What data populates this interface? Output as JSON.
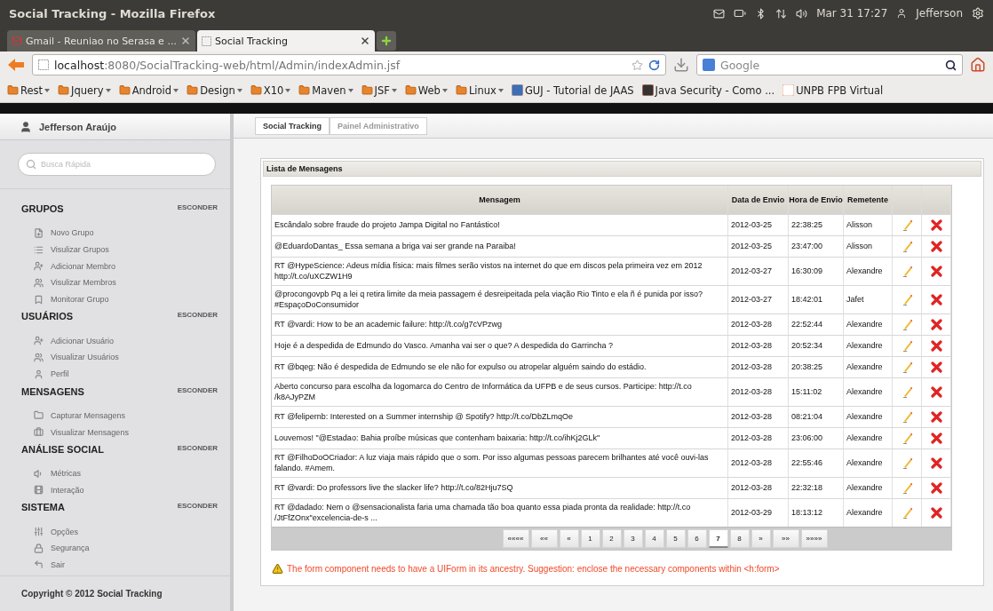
{
  "window": {
    "title": "Social Tracking - Mozilla Firefox"
  },
  "system_tray": {
    "clock": "Mar 31 17:27",
    "user": "Jefferson"
  },
  "tabs": [
    {
      "label": "Gmail - Reuniao no Serasa e ...",
      "selected": false
    },
    {
      "label": "Social Tracking",
      "selected": true
    }
  ],
  "address_bar": {
    "host": "localhost",
    "path": ":8080/SocialTracking-web/html/Admin/indexAdmin.jsf"
  },
  "web_search": {
    "placeholder": "Google"
  },
  "bookmarks": [
    {
      "label": "Rest",
      "kind": "folder"
    },
    {
      "label": "Jquery",
      "kind": "folder"
    },
    {
      "label": "Android",
      "kind": "folder"
    },
    {
      "label": "Design",
      "kind": "folder"
    },
    {
      "label": "X10",
      "kind": "folder"
    },
    {
      "label": "Maven",
      "kind": "folder"
    },
    {
      "label": "JSF",
      "kind": "folder"
    },
    {
      "label": "Web",
      "kind": "folder"
    },
    {
      "label": "Linux",
      "kind": "folder"
    },
    {
      "label": "GUJ - Tutorial de JAAS",
      "kind": "page"
    },
    {
      "label": "Java Security - Como ...",
      "kind": "page"
    },
    {
      "label": "UNPB FPB Virtual",
      "kind": "page"
    }
  ],
  "sidebar": {
    "user": "Jefferson Araújo",
    "search": {
      "placeholder": "Busca Rápida"
    },
    "sections": [
      {
        "title": "GRUPOS",
        "toggle": "ESCONDER",
        "items": [
          "Novo Grupo",
          "Visulizar Grupos",
          "Adicionar Membro",
          "Visulizar Membros",
          "Monitorar Grupo"
        ]
      },
      {
        "title": "USUÁRIOS",
        "toggle": "ESCONDER",
        "items": [
          "Adicionar Usuário",
          "Visualizar Usuários",
          "Perfil"
        ]
      },
      {
        "title": "MENSAGENS",
        "toggle": "ESCONDER",
        "items": [
          "Capturar Mensagens",
          "Visualizar Mensagens"
        ]
      },
      {
        "title": "ANÁLISE SOCIAL",
        "toggle": "ESCONDER",
        "items": [
          "Métricas",
          "Interação"
        ]
      },
      {
        "title": "SISTEMA",
        "toggle": "ESCONDER",
        "items": [
          "Opções",
          "Segurança",
          "Sair"
        ]
      }
    ],
    "footer": "Copyright © 2012 Social Tracking"
  },
  "breadcrumb": [
    "Social Tracking",
    "Painel Administrativo"
  ],
  "panel": {
    "title": "Lista de Mensagens",
    "columns": [
      "Mensagem",
      "Data de Envio",
      "Hora de Envio",
      "Remetente"
    ],
    "rows": [
      {
        "message": "Escândalo sobre fraude do projeto Jampa Digital no Fantástico!",
        "date": "2012-03-25",
        "time": "22:38:25",
        "sender": "Alisson"
      },
      {
        "message": "@EduardoDantas_ Essa semana a briga vai ser grande na Paraiba!",
        "date": "2012-03-25",
        "time": "23:47:00",
        "sender": "Alisson"
      },
      {
        "message": "RT @HypeScience: Adeus mídia física: mais filmes serão vistos na internet do que em discos pela primeira vez em 2012 http://t.co/uXCZW1H9",
        "date": "2012-03-27",
        "time": "16:30:09",
        "sender": "Alexandre"
      },
      {
        "message": "@procongovpb Pq a lei q retira limite da meia passagem é desreipeitada pela viação Rio Tinto e ela ñ é punida por isso? #EspaçoDoConsumidor",
        "date": "2012-03-27",
        "time": "18:42:01",
        "sender": "Jafet"
      },
      {
        "message": "RT @vardi: How to be an academic failure: http://t.co/g7cVPzwg",
        "date": "2012-03-28",
        "time": "22:52:44",
        "sender": "Alexandre"
      },
      {
        "message": "Hoje é a despedida de Edmundo do Vasco. Amanha vai ser o que? A despedida do Garrincha ?",
        "date": "2012-03-28",
        "time": "20:52:34",
        "sender": "Alexandre"
      },
      {
        "message": "RT @bqeg: Não é despedida de Edmundo se ele não for expulso ou atropelar alguém saindo do estádio.",
        "date": "2012-03-28",
        "time": "20:38:25",
        "sender": "Alexandre"
      },
      {
        "message": "Aberto concurso para escolha da logomarca do Centro de Informática da UFPB e de seus cursos. Participe: http://t.co /k8AJyPZM",
        "date": "2012-03-28",
        "time": "15:11:02",
        "sender": "Alexandre"
      },
      {
        "message": "RT @felipernb: Interested on a Summer internship @ Spotify? http://t.co/DbZLmqOe",
        "date": "2012-03-28",
        "time": "08:21:04",
        "sender": "Alexandre"
      },
      {
        "message": "Louvemos! \"@Estadao: Bahia proíbe músicas que contenham baixaria: http://t.co/ihKj2GLk\"",
        "date": "2012-03-28",
        "time": "23:06:00",
        "sender": "Alexandre"
      },
      {
        "message": "RT @FilhoDoOCriador: A luz viaja mais rápido que o som. Por isso algumas pessoas parecem brilhantes até você ouvi-las falando. #Amem.",
        "date": "2012-03-28",
        "time": "22:55:46",
        "sender": "Alexandre"
      },
      {
        "message": "RT @vardi: Do professors live the slacker life? http://t.co/82Hju7SQ",
        "date": "2012-03-28",
        "time": "22:32:18",
        "sender": "Alexandre"
      },
      {
        "message": "RT @dadado: Nem o @sensacionalista faria uma chamada tão boa quanto essa piada pronta da realidade: http://t.co /JtFfZOnx\"excelencia-de-s ...",
        "date": "2012-03-29",
        "time": "18:13:12",
        "sender": "Alexandre"
      }
    ],
    "pagination": [
      {
        "label": "««««",
        "selected": false
      },
      {
        "label": "««",
        "selected": false
      },
      {
        "label": "«",
        "selected": false
      },
      {
        "label": "1",
        "selected": false
      },
      {
        "label": "2",
        "selected": false
      },
      {
        "label": "3",
        "selected": false
      },
      {
        "label": "4",
        "selected": false
      },
      {
        "label": "5",
        "selected": false
      },
      {
        "label": "6",
        "selected": false
      },
      {
        "label": "7",
        "selected": true
      },
      {
        "label": "8",
        "selected": false
      },
      {
        "label": "»",
        "selected": false
      },
      {
        "label": "»»",
        "selected": false
      },
      {
        "label": "»»»»",
        "selected": false
      }
    ],
    "error": "The form component needs to have a UIForm in its ancestry. Suggestion: enclose the necessary components within <h:form>"
  }
}
